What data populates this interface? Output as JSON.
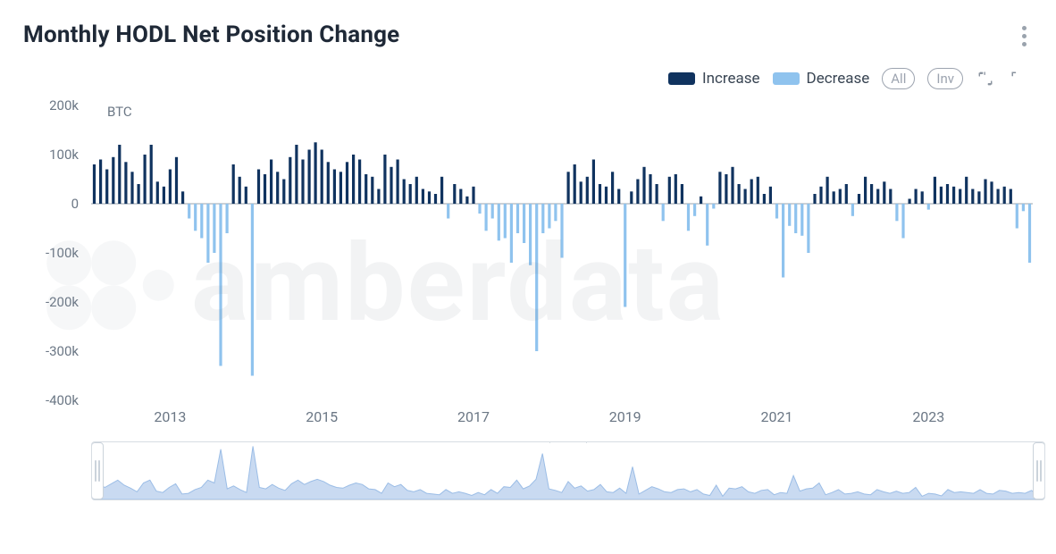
{
  "header": {
    "title": "Monthly HODL Net Position Change"
  },
  "legend": {
    "increase": "Increase",
    "decrease": "Decrease"
  },
  "controls": {
    "all": "All",
    "inv": "Inv"
  },
  "axis": {
    "unit": "BTC"
  },
  "watermark": "amberdata",
  "chart_data": {
    "type": "bar",
    "xlabel": "",
    "ylabel": "BTC",
    "ylim": [
      -400000,
      200000
    ],
    "y_ticks": [
      200000,
      100000,
      0,
      -100000,
      -200000,
      -300000,
      -400000
    ],
    "y_tick_labels": [
      "200k",
      "100k",
      "0",
      "-100k",
      "-200k",
      "-300k",
      "-400k"
    ],
    "x_ticks": [
      2013,
      2015,
      2017,
      2019,
      2021,
      2023
    ],
    "x_tick_labels": [
      "2013",
      "2015",
      "2017",
      "2019",
      "2021",
      "2023"
    ],
    "x_start": "2012-01",
    "x_end": "2024-02",
    "series": [
      {
        "name": "Increase",
        "color": "#10335f",
        "kind": "positive"
      },
      {
        "name": "Decrease",
        "color": "#8fc3ee",
        "kind": "negative"
      }
    ],
    "values": [
      80000,
      90000,
      70000,
      95000,
      120000,
      85000,
      65000,
      40000,
      100000,
      120000,
      45000,
      35000,
      70000,
      95000,
      25000,
      -30000,
      -55000,
      -70000,
      -120000,
      -100000,
      -330000,
      -60000,
      80000,
      55000,
      35000,
      -350000,
      70000,
      60000,
      90000,
      65000,
      50000,
      95000,
      120000,
      90000,
      110000,
      125000,
      110000,
      85000,
      70000,
      65000,
      85000,
      100000,
      90000,
      60000,
      55000,
      30000,
      100000,
      75000,
      90000,
      50000,
      40000,
      55000,
      30000,
      25000,
      20000,
      55000,
      -30000,
      40000,
      30000,
      15000,
      35000,
      -20000,
      -55000,
      -30000,
      -75000,
      -70000,
      -120000,
      -60000,
      -80000,
      -125000,
      -300000,
      -60000,
      -50000,
      -35000,
      -110000,
      65000,
      80000,
      45000,
      55000,
      90000,
      40000,
      35000,
      65000,
      30000,
      -210000,
      25000,
      50000,
      75000,
      60000,
      40000,
      -35000,
      55000,
      60000,
      40000,
      -55000,
      -25000,
      15000,
      -85000,
      -10000,
      65000,
      60000,
      75000,
      40000,
      30000,
      50000,
      55000,
      20000,
      35000,
      -30000,
      -150000,
      -45000,
      -60000,
      -65000,
      -100000,
      20000,
      35000,
      55000,
      25000,
      30000,
      40000,
      -25000,
      20000,
      55000,
      40000,
      30000,
      45000,
      30000,
      -35000,
      -70000,
      10000,
      30000,
      25000,
      -12000,
      55000,
      35000,
      40000,
      35000,
      30000,
      55000,
      30000,
      25000,
      50000,
      45000,
      30000,
      35000,
      30000,
      -50000,
      -15000,
      -120000
    ]
  }
}
